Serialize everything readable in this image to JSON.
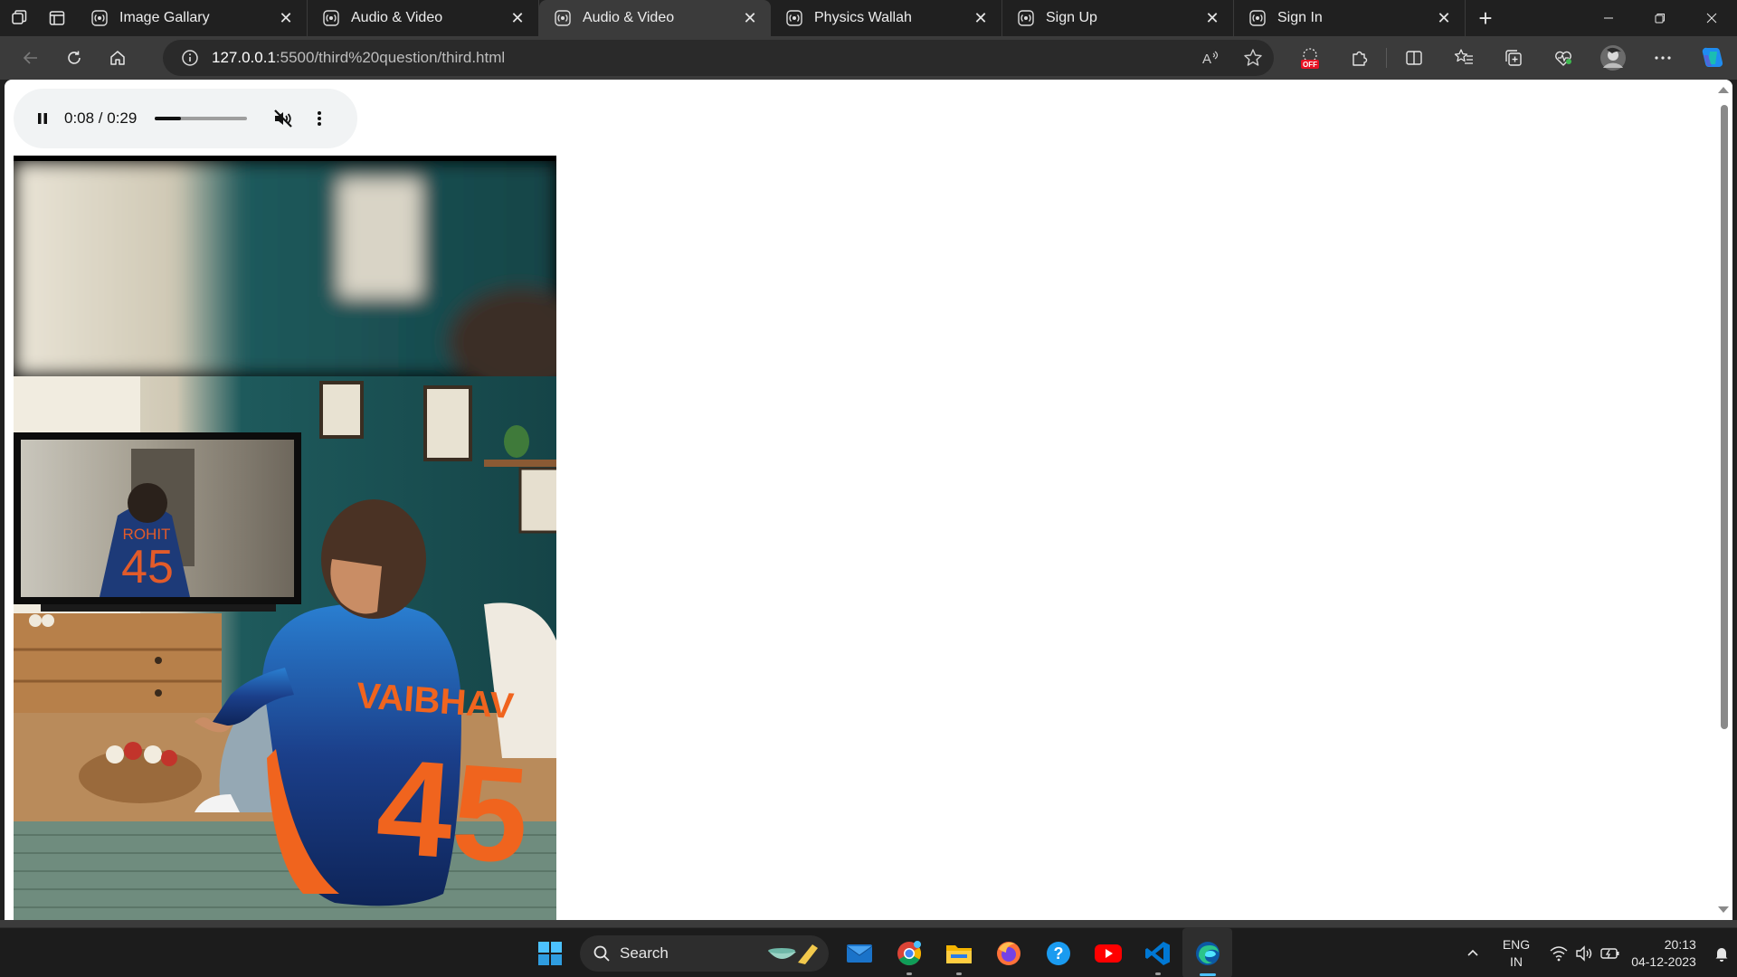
{
  "browser": {
    "tabs": [
      {
        "title": "Image Gallary",
        "active": false
      },
      {
        "title": "Audio & Video",
        "active": false
      },
      {
        "title": "Audio & Video",
        "active": true
      },
      {
        "title": "Physics Wallah",
        "active": false
      },
      {
        "title": "Sign Up",
        "active": false
      },
      {
        "title": "Sign In",
        "active": false
      }
    ],
    "address": {
      "host": "127.0.0.1",
      "path": ":5500/third%20question/third.html"
    },
    "extension_badge": "OFF"
  },
  "page": {
    "audio_player": {
      "state": "playing",
      "time_display": "0:08 / 0:29",
      "progress_fraction": 0.28,
      "muted": true
    },
    "video": {
      "jersey_main_name": "VAIBHAV",
      "jersey_main_number": "45",
      "tv_jersey_name": "ROHIT",
      "tv_jersey_number": "45"
    }
  },
  "taskbar": {
    "search_label": "Search",
    "language_line1": "ENG",
    "language_line2": "IN",
    "time": "20:13",
    "date": "04-12-2023",
    "accent": "#4cc2ff"
  }
}
